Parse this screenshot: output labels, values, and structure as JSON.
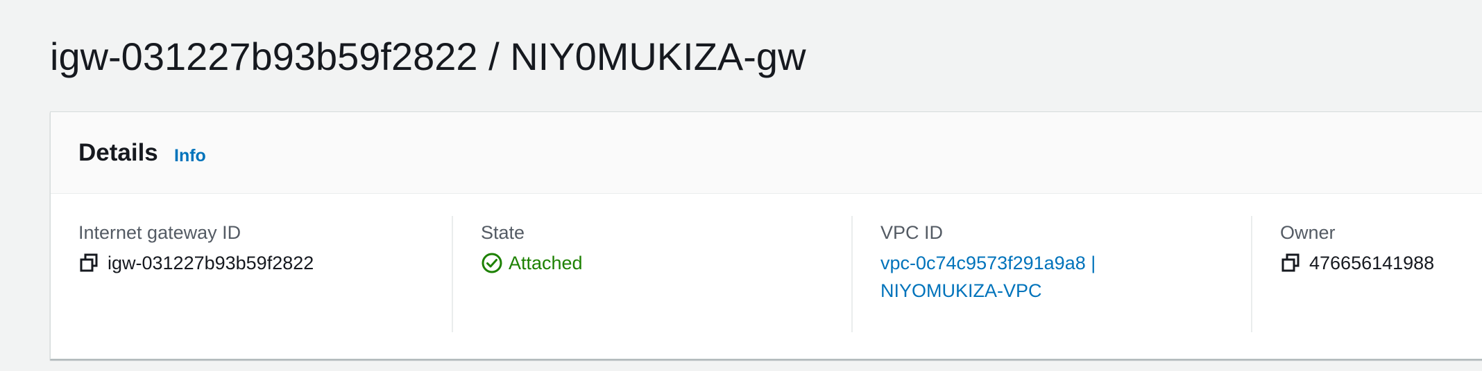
{
  "page": {
    "title": "igw-031227b93b59f2822 / NIY0MUKIZA-gw"
  },
  "details": {
    "title": "Details",
    "info_label": "Info",
    "fields": {
      "gateway_id": {
        "label": "Internet gateway ID",
        "value": "igw-031227b93b59f2822"
      },
      "state": {
        "label": "State",
        "value": "Attached"
      },
      "vpc_id": {
        "label": "VPC ID",
        "value_line1": "vpc-0c74c9573f291a9a8 |",
        "value_line2": "NIYOMUKIZA-VPC"
      },
      "owner": {
        "label": "Owner",
        "value": "476656141988"
      }
    }
  },
  "icons": {
    "copy": "copy-icon",
    "status_success": "status-success-icon"
  },
  "colors": {
    "link": "#0073bb",
    "success": "#1d8102",
    "text": "#16191f",
    "label": "#545b64",
    "background": "#f2f3f3"
  }
}
